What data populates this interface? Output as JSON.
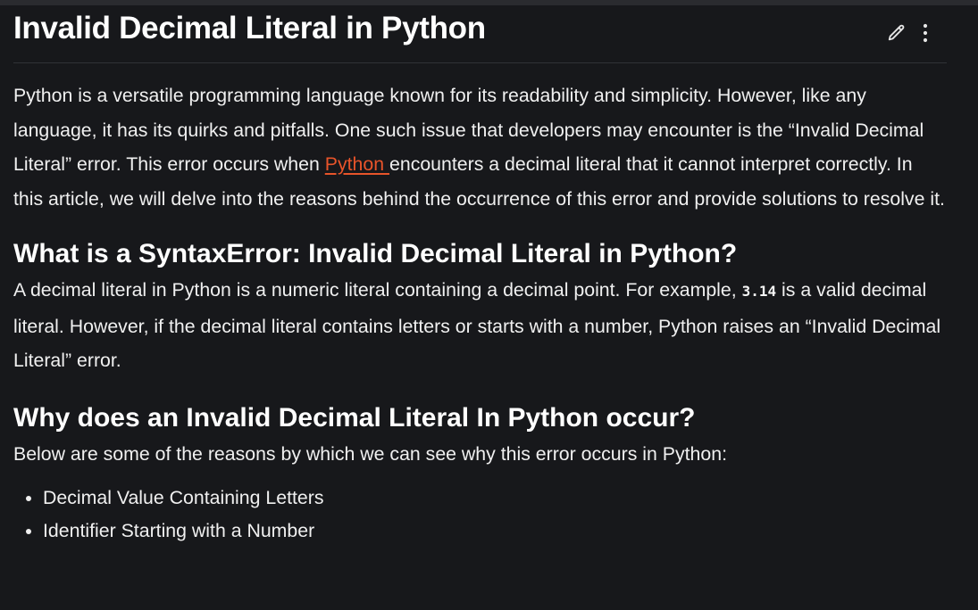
{
  "article": {
    "title": "Invalid Decimal Literal in Python",
    "intro": {
      "before_link": "Python is a versatile programming language known for its readability and simplicity. However, like any language, it has its quirks and pitfalls. One such issue that developers may encounter is the “Invalid Decimal Literal” error. This error occurs when ",
      "link_text": "Python ",
      "after_link": "encounters a decimal literal that it cannot interpret correctly. In this article, we will delve into the reasons behind the occurrence of this error and provide solutions to resolve it."
    },
    "section1": {
      "heading": "What is a SyntaxError: Invalid Decimal Literal in Python?",
      "text_before_code": "A decimal literal in Python is a numeric literal containing a decimal point. For example, ",
      "code": "3.14",
      "text_after_code": " is a valid decimal literal. However, if the decimal literal contains letters or starts with a number, Python raises an “Invalid Decimal Literal” error."
    },
    "section2": {
      "heading": "Why does an Invalid Decimal Literal In Python occur?",
      "text": "Below are some of the reasons by which we can see why this error occurs in Python:",
      "items": [
        "Decimal Value Containing Letters",
        "Identifier Starting with a Number"
      ]
    }
  },
  "colors": {
    "background": "#17181b",
    "text": "#f0f0f0",
    "link": "#e8542a",
    "divider": "#303236"
  },
  "icons": {
    "edit": "pencil-icon",
    "more": "more-vertical-icon"
  }
}
